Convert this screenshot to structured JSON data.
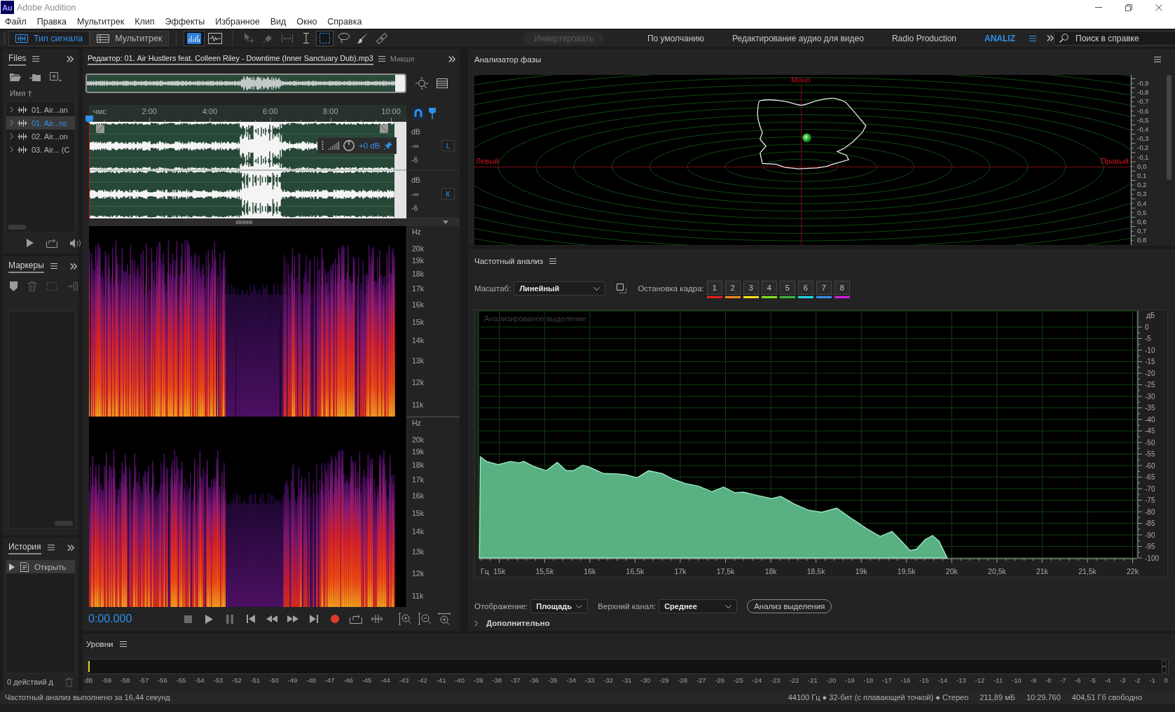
{
  "window": {
    "badge": "Au",
    "title": "Adobe Audition"
  },
  "menu": [
    "Файл",
    "Правка",
    "Мультитрек",
    "Клип",
    "Эффекты",
    "Избранное",
    "Вид",
    "Окно",
    "Справка"
  ],
  "toolbar": {
    "modes": [
      {
        "kind": "waveform",
        "label": "Тип сигнала",
        "selected": true
      },
      {
        "kind": "multitrack",
        "label": "Мультитрек",
        "selected": false
      }
    ],
    "views": [
      {
        "kind": "spectral",
        "selected": true
      },
      {
        "kind": "waveform",
        "selected": false
      }
    ],
    "tools": [
      {
        "kind": "move",
        "selected": false,
        "disabled": true
      },
      {
        "kind": "razor",
        "selected": false,
        "disabled": true
      },
      {
        "kind": "slip",
        "selected": false,
        "disabled": true
      },
      {
        "kind": "time",
        "selected": false,
        "disabled": false
      },
      {
        "kind": "marquee",
        "selected": true,
        "disabled": false
      },
      {
        "kind": "lasso",
        "selected": false,
        "disabled": false
      },
      {
        "kind": "brush",
        "selected": false,
        "disabled": false
      },
      {
        "kind": "heal",
        "selected": false,
        "disabled": false
      }
    ],
    "invert": {
      "label": "Инвертировать",
      "disabled": true
    },
    "workspaces": [
      {
        "label": "По умолчанию",
        "selected": false
      },
      {
        "label": "Редактирование аудио для видео",
        "selected": false
      },
      {
        "label": "Radio Production",
        "selected": false
      },
      {
        "label": "ANALIZ",
        "selected": true
      }
    ],
    "search": {
      "placeholder": "Поиск в справке"
    }
  },
  "files": {
    "tab": "Files",
    "sort_column": "Имя",
    "items": [
      {
        "name": "01. Air...an",
        "selected": false
      },
      {
        "name": "01. Air...nc",
        "selected": true
      },
      {
        "name": "02. Air...on",
        "selected": false
      },
      {
        "name": "03. Air... (C",
        "selected": false
      }
    ]
  },
  "markers": {
    "tab": "Маркеры"
  },
  "history": {
    "tab": "История",
    "items": [
      {
        "label": "Открыть",
        "selected": true
      }
    ],
    "status": "0 действий д"
  },
  "editor": {
    "tab": "Редактор: 01. Air Hustlers feat. Colleen Riley - Downtime (Inner Sanctuary Dub).mp3",
    "next_tab": "Микше",
    "ruler": [
      "чмс",
      "2:00",
      "4:00",
      "6:00",
      "8:00",
      "10:00"
    ],
    "channels": [
      {
        "button": "L",
        "scale": [
          "dB",
          "-∞",
          "-6"
        ]
      },
      {
        "button": "K",
        "scale": [
          "dB",
          "-∞",
          "-6"
        ]
      }
    ],
    "gain": "+0 dB",
    "spectrograms": [
      {
        "unit": "Hz",
        "ticks": [
          "20k",
          "19k",
          "18k",
          "17k",
          "16k",
          "15k",
          "14k",
          "13k",
          "12k",
          "11k"
        ]
      },
      {
        "unit": "Hz",
        "ticks": [
          "20k",
          "19k",
          "18k",
          "17k",
          "16k",
          "15k",
          "14k",
          "13k",
          "12k",
          "11k"
        ]
      }
    ],
    "time": "0:00.000"
  },
  "phase": {
    "title": "Анализатор фазы",
    "mono": "Моно",
    "left": "Левый",
    "right": "Правый",
    "scale": [
      "-0,9",
      "-0,8",
      "-0,7",
      "-0,6",
      "-0,5",
      "-0,4",
      "-0,3",
      "-0,2",
      "-0,1",
      "0,0",
      "0,1",
      "0,2",
      "0,3",
      "0,4",
      "0,5",
      "0,6",
      "0,7",
      "0,8"
    ]
  },
  "frequency": {
    "title": "Частотный анализ",
    "scale": {
      "label": "Масштаб:",
      "value": "Линейный"
    },
    "freeze": {
      "label": "Остановка кадра:",
      "frames": [
        {
          "label": "1",
          "color": "#e3201b"
        },
        {
          "label": "2",
          "color": "#f0861c"
        },
        {
          "label": "3",
          "color": "#f2e01e"
        },
        {
          "label": "4",
          "color": "#7ee21e"
        },
        {
          "label": "5",
          "color": "#3cb83c"
        },
        {
          "label": "6",
          "color": "#1ed6e6"
        },
        {
          "label": "7",
          "color": "#3a8ee8"
        },
        {
          "label": "8",
          "color": "#d41ee0"
        }
      ]
    },
    "chart_data": {
      "type": "area",
      "title": "Анализированое выделение",
      "xlabel": "Гц",
      "ylabel": "дБ",
      "x": [
        14.78,
        14.79,
        14.86,
        14.99,
        15.12,
        15.22,
        15.27,
        15.37,
        15.52,
        15.64,
        15.74,
        15.82,
        15.92,
        15.99,
        16.15,
        16.3,
        16.4,
        16.52,
        16.65,
        16.8,
        16.92,
        17.05,
        17.2,
        17.35,
        17.48,
        17.6,
        17.7,
        17.85,
        18.01,
        18.11,
        18.26,
        18.41,
        18.56,
        18.73,
        18.91,
        19.06,
        19.21,
        19.34,
        19.44,
        19.54,
        19.61,
        19.71,
        19.79,
        19.86,
        19.94,
        19.95
      ],
      "values": [
        -100,
        -56.2,
        -58.2,
        -59.6,
        -58.2,
        -58.8,
        -58.2,
        -60.2,
        -62.2,
        -58.6,
        -62.2,
        -62.2,
        -59.8,
        -60.6,
        -63.4,
        -63.6,
        -64,
        -65.3,
        -62.2,
        -63.4,
        -65.9,
        -67.7,
        -68.9,
        -71.3,
        -69.3,
        -71.7,
        -71.5,
        -72.9,
        -74.3,
        -73.3,
        -76.6,
        -79.2,
        -80.2,
        -78.4,
        -83.4,
        -87.3,
        -90.7,
        -88.5,
        -92.5,
        -96.8,
        -96.2,
        -91.9,
        -90.3,
        -92.7,
        -99.2,
        -100
      ],
      "xlim": [
        14.77,
        22.05
      ],
      "ylim": [
        -100,
        7
      ],
      "xticks": [
        {
          "value": 15,
          "label": "15k"
        },
        {
          "value": 15.5,
          "label": "15,5k"
        },
        {
          "value": 16,
          "label": "16k"
        },
        {
          "value": 16.5,
          "label": "16,5k"
        },
        {
          "value": 17,
          "label": "17k"
        },
        {
          "value": 17.5,
          "label": "17,5k"
        },
        {
          "value": 18,
          "label": "18k"
        },
        {
          "value": 18.5,
          "label": "18,5k"
        },
        {
          "value": 19,
          "label": "19k"
        },
        {
          "value": 19.5,
          "label": "19,5k"
        },
        {
          "value": 20,
          "label": "20k"
        },
        {
          "value": 20.5,
          "label": "20,5k"
        },
        {
          "value": 21,
          "label": "21k"
        },
        {
          "value": 21.5,
          "label": "21,5k"
        },
        {
          "value": 22,
          "label": "22k"
        }
      ],
      "yticks": [
        0,
        -5,
        -10,
        -15,
        -20,
        -25,
        -30,
        -35,
        -40,
        -45,
        -50,
        -55,
        -60,
        -65,
        -70,
        -75,
        -80,
        -85,
        -90,
        -95,
        -100
      ],
      "grid": true
    },
    "display": {
      "label": "Отображение:",
      "value": "Площадь"
    },
    "top_channel": {
      "label": "Верхний канал:",
      "value": "Среднее"
    },
    "analyze_button": "Анализ выделения",
    "advanced": {
      "label": "Дополнительно",
      "expanded": false
    }
  },
  "levels": {
    "title": "Уровни",
    "scale": [
      "dB",
      "-59",
      "-58",
      "-57",
      "-56",
      "-55",
      "-54",
      "-53",
      "-52",
      "-51",
      "-50",
      "-49",
      "-48",
      "-47",
      "-46",
      "-45",
      "-44",
      "-43",
      "-42",
      "-41",
      "-40",
      "-39",
      "-38",
      "-37",
      "-36",
      "-35",
      "-34",
      "-33",
      "-32",
      "-31",
      "-30",
      "-29",
      "-28",
      "-27",
      "-26",
      "-25",
      "-24",
      "-23",
      "-22",
      "-21",
      "-20",
      "-19",
      "-18",
      "-17",
      "-16",
      "-15",
      "-14",
      "-13",
      "-12",
      "-11",
      "-10",
      "-9",
      "-8",
      "-7",
      "-6",
      "-5",
      "-4",
      "-3",
      "-2",
      "-1",
      "0"
    ]
  },
  "status_bar": {
    "message": "Частотный анализ выполнено за 16,44 секунд",
    "format": "44100 Гц ● 32-бит (с плавающей точкой) ● Стерео",
    "size": "211,89 мБ",
    "duration": "10:29.760",
    "free": "404,51 Гб свободно"
  }
}
